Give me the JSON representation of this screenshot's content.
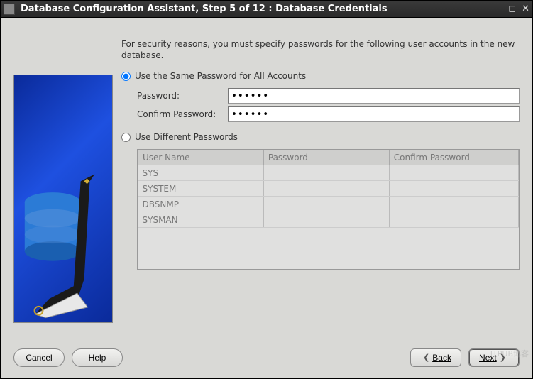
{
  "window": {
    "title": "Database Configuration Assistant, Step 5 of 12 : Database Credentials"
  },
  "instruction": "For security reasons, you must specify passwords for the following user accounts in the new database.",
  "option_same": {
    "label": "Use the Same Password for All Accounts",
    "selected": true,
    "password": {
      "label": "Password:",
      "value": "******"
    },
    "confirm": {
      "label": "Confirm Password:",
      "value": "******"
    }
  },
  "option_diff": {
    "label": "Use Different Passwords",
    "selected": false,
    "columns": [
      "User Name",
      "Password",
      "Confirm Password"
    ],
    "rows": [
      {
        "user": "SYS",
        "password": "",
        "confirm": ""
      },
      {
        "user": "SYSTEM",
        "password": "",
        "confirm": ""
      },
      {
        "user": "DBSNMP",
        "password": "",
        "confirm": ""
      },
      {
        "user": "SYSMAN",
        "password": "",
        "confirm": ""
      }
    ]
  },
  "buttons": {
    "cancel": "Cancel",
    "help": "Help",
    "back": "Back",
    "next": "Next"
  },
  "watermark": "ITPUB博客"
}
